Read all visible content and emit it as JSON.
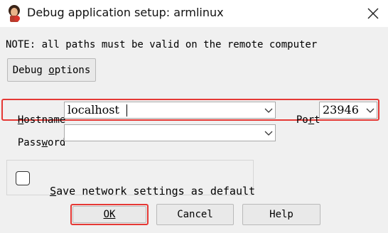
{
  "window": {
    "title": "Debug application setup: armlinux",
    "app_icon": "ida-icon",
    "close_icon": "close-icon"
  },
  "note": "NOTE: all paths must be valid on the remote computer",
  "debug_options_button": {
    "prefix": "Debug ",
    "underlined": "o",
    "suffix": "ptions"
  },
  "hostname": {
    "label_underlined": "H",
    "label_rest": "ostname",
    "value": "localhost"
  },
  "port": {
    "label_prefix": "Po",
    "label_underlined": "r",
    "label_rest": "t",
    "value": "23946"
  },
  "password": {
    "label_prefix": "Pass",
    "label_underlined": "w",
    "label_rest": "ord",
    "value": ""
  },
  "save_settings": {
    "label_underlined": "S",
    "label_rest": "ave network settings as default",
    "checked": false
  },
  "buttons": {
    "ok_underlined": "O",
    "ok_rest": "K",
    "cancel": "Cancel",
    "help": "Help"
  },
  "colors": {
    "highlight": "#e53935",
    "background": "#f0f0f0"
  }
}
